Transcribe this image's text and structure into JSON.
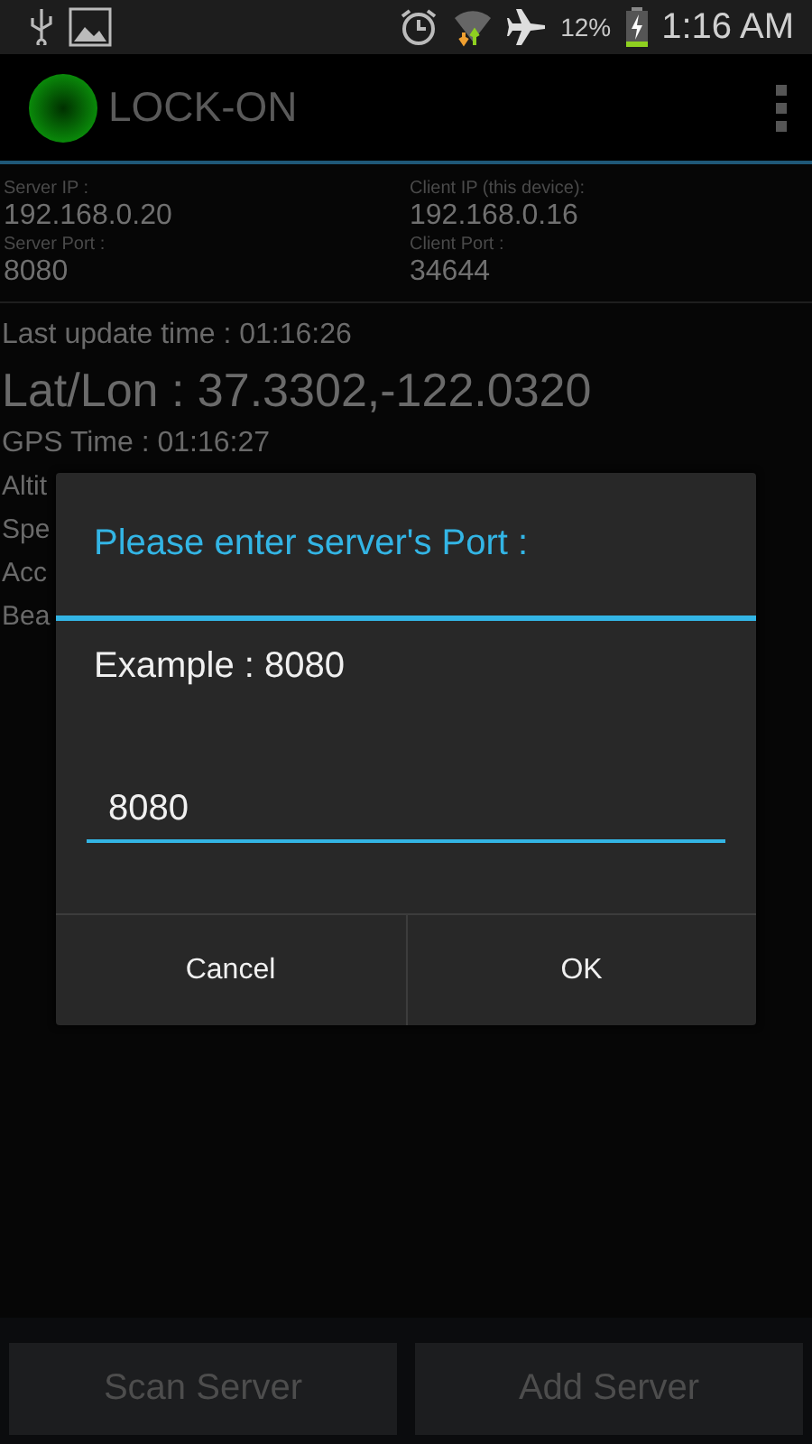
{
  "status_bar": {
    "battery_text": "12%",
    "time": "1:16 AM"
  },
  "action_bar": {
    "title": "LOCK-ON"
  },
  "connection": [
    {
      "label": "Server IP :",
      "value": "192.168.0.20"
    },
    {
      "label": "Client IP (this device):",
      "value": "192.168.0.16"
    },
    {
      "label": "Server Port :",
      "value": "8080"
    },
    {
      "label": "Client Port :",
      "value": "34644"
    }
  ],
  "last_update": "Last update time : 01:16:26",
  "lat_lon": "Lat/Lon : 37.3302,-122.0320",
  "details": [
    "GPS Time : 01:16:27",
    "Altit",
    "Spe",
    "Acc",
    "Bea"
  ],
  "dialog": {
    "title": "Please enter server's Port :",
    "message": "Example : 8080",
    "value": "8080",
    "buttons": [
      "Cancel",
      "OK"
    ]
  },
  "bottom_buttons": [
    "Scan Server",
    "Add Server"
  ]
}
